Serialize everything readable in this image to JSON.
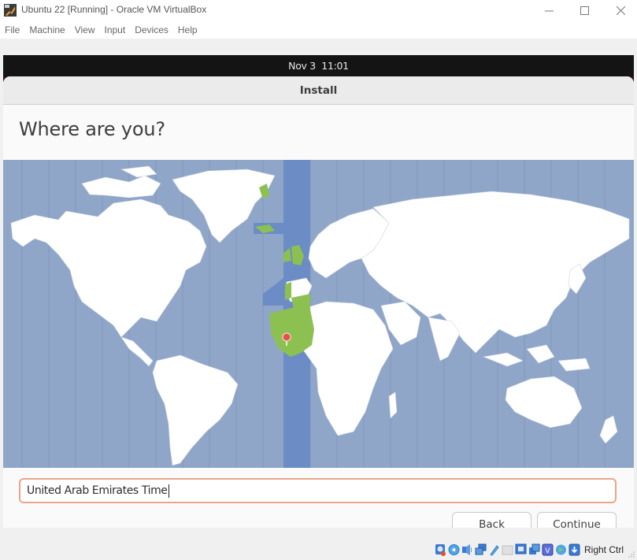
{
  "window": {
    "title": "Ubuntu 22 [Running] - Oracle VM VirtualBox",
    "controls": {
      "minimize": "—",
      "maximize": "☐",
      "close": "✕"
    }
  },
  "menubar": {
    "items": [
      "File",
      "Machine",
      "View",
      "Input",
      "Devices",
      "Help"
    ]
  },
  "guest": {
    "clock": "Nov 3  11:01",
    "installer": {
      "header_title": "Install",
      "heading": "Where are you?",
      "map": {
        "selected_timezone_region_color": "#8cc152",
        "highlight_band_color": "#6b8cc4",
        "ocean_color": "#8fa6c9",
        "land_color": "#ffffff",
        "pin_color": "#e8504a"
      },
      "timezone_input": {
        "value": "United Arab Emirates Time",
        "border_color": "#eaa58a"
      },
      "buttons": {
        "back": "Back",
        "continue": "Continue"
      }
    }
  },
  "statusbar": {
    "icons": [
      "hard-disk-icon",
      "optical-disk-icon",
      "audio-icon",
      "network-icon",
      "usb-icon",
      "shared-folders-icon",
      "display-icon",
      "video-capture-icon",
      "cpu-virtualization-icon",
      "guest-additions-icon",
      "mouse-integration-icon"
    ],
    "host_key": "Right Ctrl"
  }
}
